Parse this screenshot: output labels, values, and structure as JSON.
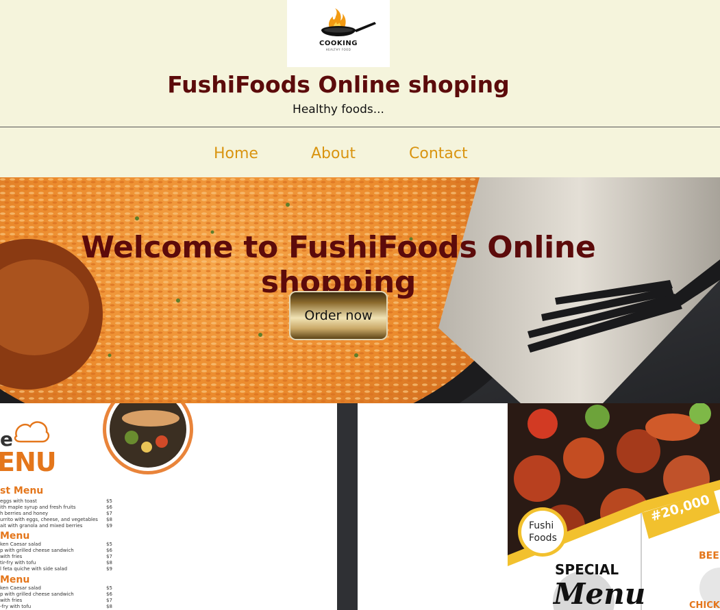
{
  "header": {
    "logo_text": "COOKING",
    "logo_subtext": "HEALTHY FOOD",
    "title": "FushiFoods Online shoping",
    "tagline": "Healthy foods..."
  },
  "nav": {
    "items": [
      {
        "label": "Home"
      },
      {
        "label": "About"
      },
      {
        "label": "Contact"
      }
    ]
  },
  "hero": {
    "title": "Welcome to FushiFoods Online shopping",
    "button_label": "Order now"
  },
  "menu_card_left": {
    "logo_text": "e",
    "menu_word": "ENU",
    "sections": [
      {
        "title": "st Menu",
        "items": [
          {
            "name": "eggs with toast",
            "price": "$5"
          },
          {
            "name": "ith maple syrup and fresh fruits",
            "price": "$6"
          },
          {
            "name": "h berries and honey",
            "price": "$7"
          },
          {
            "name": "urrito with eggs, cheese, and vegetables",
            "price": "$8"
          },
          {
            "name": "ait with granola and mixed berries",
            "price": "$9"
          }
        ]
      },
      {
        "title": "Menu",
        "items": [
          {
            "name": "ken Caesar salad",
            "price": "$5"
          },
          {
            "name": "p with grilled cheese sandwich",
            "price": "$6"
          },
          {
            "name": "with fries",
            "price": "$7"
          },
          {
            "name": "tir-fry with tofu",
            "price": "$8"
          },
          {
            "name": "l feta quiche with side salad",
            "price": "$9"
          }
        ]
      },
      {
        "title": "Menu",
        "items": [
          {
            "name": "ken Caesar salad",
            "price": "$5"
          },
          {
            "name": "p with grilled cheese sandwich",
            "price": "$6"
          },
          {
            "name": "with fries",
            "price": "$7"
          },
          {
            "name": "-fry with tofu",
            "price": "$8"
          }
        ]
      }
    ]
  },
  "menu_card_right": {
    "brand_line1": "Fushi",
    "brand_line2": "Foods",
    "special": "SPECIAL",
    "menu_script": "Menu",
    "price_tag": "#20,000",
    "side_label_1": "BEE",
    "side_label_2": "CHICK"
  },
  "colors": {
    "background": "#f5f4dc",
    "title": "#5c0b0b",
    "nav": "#d99410",
    "menu_accent": "#e4761b"
  }
}
